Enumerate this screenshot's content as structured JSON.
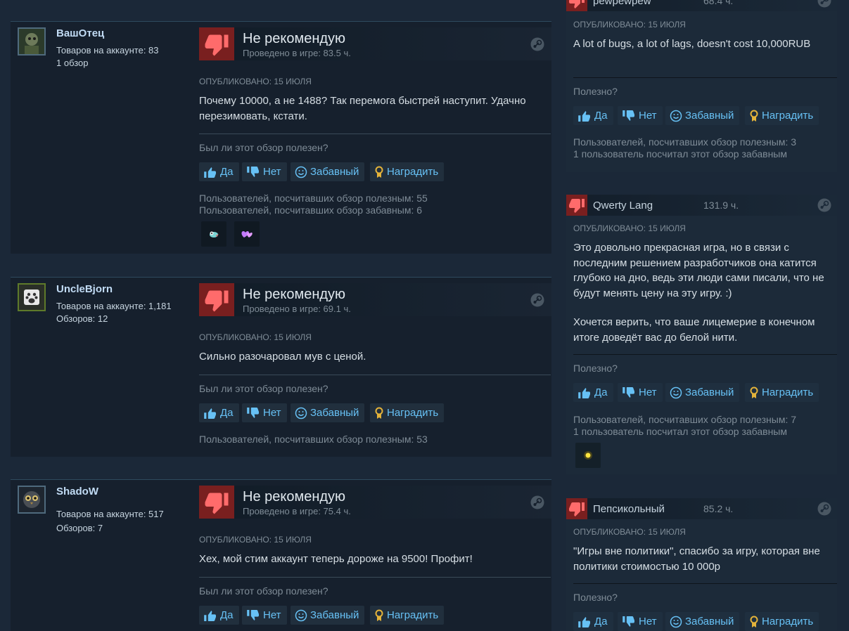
{
  "common": {
    "not_recommended": "Не рекомендую",
    "helpful_question": "Был ли этот обзор полезен?",
    "helpful_short": "Полезно?",
    "yes": "Да",
    "no": "Нет",
    "funny": "Забавный",
    "award": "Наградить"
  },
  "reviews": [
    {
      "author": "ВашОтец",
      "info1": "Товаров на аккаунте: 83",
      "info2": "1 обзор",
      "hours": "Проведено в игре: 83.5 ч.",
      "posted": "Опубликовано: 15 июля",
      "text": "Почему 10000, а не 1488? Так перемога быстрей наступит. Удачно перезимовать, кстати.",
      "count1": "Пользователей, посчитавших обзор полезным: 55",
      "count2": "Пользователей, посчитавших обзор забавным: 6"
    },
    {
      "author": "UncleBjorn",
      "info1": "Товаров на аккаунте: 1,181",
      "info2": "Обзоров: 12",
      "hours": "Проведено в игре: 69.1 ч.",
      "posted": "Опубликовано: 15 июля",
      "text": "Сильно разочаровал мув с ценой.",
      "count1": "Пользователей, посчитавших обзор полезным: 53"
    },
    {
      "author": "ShadoW",
      "info1": "Товаров на аккаунте: 517",
      "info2": "Обзоров: 7",
      "hours": "Проведено в игре: 75.4 ч.",
      "posted": "Опубликовано: 15 июля",
      "text": "Хех, мой стим аккаунт теперь дороже на 9500! Профит!"
    }
  ],
  "right_reviews": [
    {
      "author": "pewpewpew",
      "hours": "68.4 ч.",
      "posted": "Опубликовано: 15 июля",
      "text": "A lot of bugs, a lot of lags, doesn't cost 10,000RUB",
      "count1": "Пользователей, посчитавших обзор полезным: 3",
      "count2": "1 пользователь посчитал этот обзор забавным"
    },
    {
      "author": "Qwerty Lang",
      "hours": "131.9 ч.",
      "posted": "Опубликовано: 15 июля",
      "text": "Это довольно прекрасная игра, но в связи с последним решением разработчиков она катится глубоко на дно, ведь эти люди сами писали, что не будут менять цену на эту игру. :)",
      "text2": "Хочется верить, что ваше лицемерие в конечном итоге доведёт вас до белой нити.",
      "count1": "Пользователей, посчитавших обзор полезным: 7",
      "count2": "1 пользователь посчитал этот обзор забавным"
    },
    {
      "author": "Пепсикольный",
      "hours": "85.2 ч.",
      "posted": "Опубликовано: 15 июля",
      "text": "\"Игры вне политики\", спасибо за игру, которая вне политики стоимостью 10 000р"
    }
  ],
  "colors": {
    "background": "#1b2838",
    "panel": "#16202d",
    "thumb_down_bg": "#791f1f",
    "link": "#67c1f5",
    "award_gold": "#e4b33a"
  }
}
